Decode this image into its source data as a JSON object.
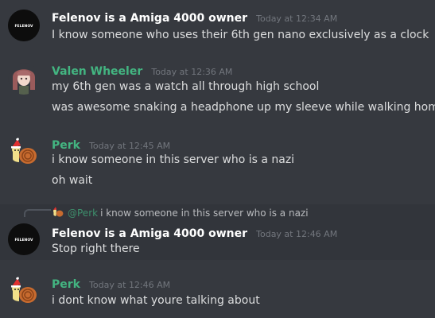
{
  "messages": [
    {
      "author": "Felenov is a Amiga 4000 owner",
      "author_color": "#ffffff",
      "time": "Today at 12:34 AM",
      "avatar": "felenov-logo",
      "lines": [
        "I know someone who uses their 6th gen nano exclusively as a clock"
      ]
    },
    {
      "author": "Valen Wheeler",
      "author_color": "#43b581",
      "time": "Today at 12:36 AM",
      "avatar": "anime-girl",
      "lines": [
        "my 6th gen was a watch all through high school",
        "was awesome snaking a headphone up my sleeve while walking home"
      ]
    },
    {
      "author": "Perk",
      "author_color": "#43b581",
      "time": "Today at 12:45 AM",
      "avatar": "snail-santa",
      "lines": [
        "i know someone in this server who is a nazi",
        "oh wait"
      ]
    },
    {
      "reply_to": {
        "mention": "@Perk",
        "text": "i know someone in this server who is a nazi"
      },
      "author": "Felenov is a Amiga 4000 owner",
      "author_color": "#ffffff",
      "time": "Today at 12:46 AM",
      "avatar": "felenov-logo",
      "lines": [
        "Stop right there"
      ]
    },
    {
      "author": "Perk",
      "author_color": "#43b581",
      "time": "Today at 12:46 AM",
      "avatar": "snail-santa",
      "lines": [
        "i dont know what youre talking about"
      ]
    }
  ],
  "logo_text": "FELENOV"
}
